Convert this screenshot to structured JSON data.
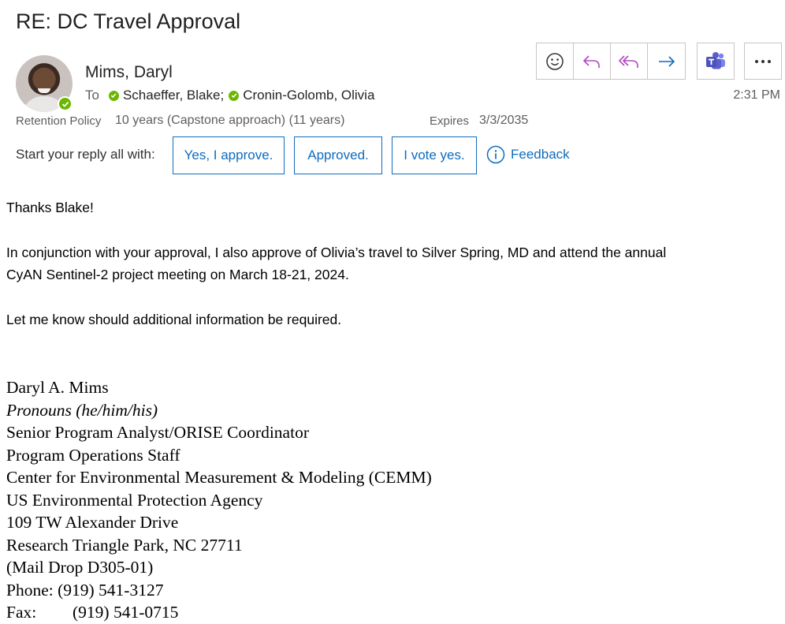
{
  "email": {
    "subject": "RE: DC Travel Approval",
    "sender": "Mims, Daryl",
    "to_label": "To",
    "recipients": [
      "Schaeffer, Blake;",
      "Cronin-Golomb, Olivia"
    ],
    "time": "2:31 PM",
    "retention_label": "Retention Policy",
    "retention_value": "10 years (Capstone approach) (11 years)",
    "expires_label": "Expires",
    "expires_value": "3/3/2035"
  },
  "toolbar": {
    "icons": [
      "emoji-icon",
      "reply-icon",
      "reply-all-icon",
      "forward-icon",
      "teams-icon",
      "more-icon"
    ]
  },
  "quick_reply": {
    "label": "Start your reply all with:",
    "options": [
      "Yes, I approve.",
      "Approved.",
      "I vote yes."
    ],
    "feedback": "Feedback"
  },
  "body": {
    "greeting": "Thanks Blake!",
    "para1_line1": "In conjunction with your approval, I also approve of Olivia’s travel to Silver Spring, MD and attend the annual",
    "para1_line2": "CyAN Sentinel-2 project meeting on March 18-21, 2024.",
    "para2": "Let me know should additional information be required."
  },
  "signature": {
    "name": "Daryl A. Mims",
    "pronouns": "Pronouns (he/him/his)",
    "title": "Senior Program Analyst/ORISE Coordinator",
    "dept": "Program Operations Staff",
    "center": "Center for Environmental Measurement & Modeling (CEMM)",
    "agency": "US Environmental Protection Agency",
    "address1": "109 TW Alexander Drive",
    "address2": "Research Triangle Park, NC 27711",
    "maildrop": "(Mail Drop D305-01)",
    "phone": "Phone: (919) 541-3127",
    "fax_label": "Fax:",
    "fax": "(919) 541-0715"
  },
  "colors": {
    "accent": "#0f6cbd",
    "presence": "#6bb700",
    "reply_purple": "#b146c2",
    "teams": "#5b5fc7"
  }
}
